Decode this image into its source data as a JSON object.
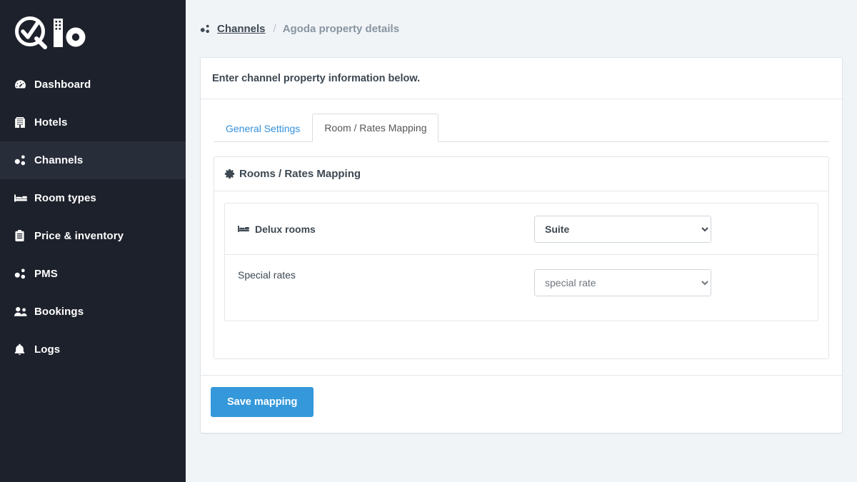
{
  "brand": {
    "logo_text": "io",
    "logo_name": "qio-logo"
  },
  "sidebar": {
    "items": [
      {
        "label": "Dashboard",
        "icon": "dashboard-gauge-icon",
        "active": false
      },
      {
        "label": "Hotels",
        "icon": "building-icon",
        "active": false
      },
      {
        "label": "Channels",
        "icon": "channels-nodes-icon",
        "active": true
      },
      {
        "label": "Room types",
        "icon": "bed-icon",
        "active": false
      },
      {
        "label": "Price & inventory",
        "icon": "clipboard-icon",
        "active": false
      },
      {
        "label": "PMS",
        "icon": "channels-nodes-icon",
        "active": false
      },
      {
        "label": "Bookings",
        "icon": "users-icon",
        "active": false
      },
      {
        "label": "Logs",
        "icon": "bell-icon",
        "active": false
      }
    ]
  },
  "breadcrumb": {
    "icon": "channels-nodes-icon",
    "current": "Channels",
    "separator": "/",
    "trail": "Agoda property details"
  },
  "card": {
    "header": "Enter channel property information below."
  },
  "tabs": [
    {
      "label": "General Settings",
      "active": false
    },
    {
      "label": "Room / Rates Mapping",
      "active": true
    }
  ],
  "panel": {
    "icon": "gear-icon",
    "title": "Rooms / Rates Mapping",
    "rows": [
      {
        "label": "Delux rooms",
        "icon": "bed-icon",
        "bold": true,
        "select_value": "Suite",
        "select_options": [
          "Suite"
        ],
        "select_style": "strong"
      },
      {
        "label": "Special rates",
        "icon": "",
        "bold": false,
        "select_value": "special rate",
        "select_options": [
          "special rate"
        ],
        "select_style": "muted"
      }
    ]
  },
  "footer": {
    "save_label": "Save mapping"
  },
  "colors": {
    "sidebar_bg": "#1d212b",
    "sidebar_active_bg": "#282d3a",
    "page_bg": "#f1f4f7",
    "primary": "#3498db",
    "link": "#3490dc",
    "text": "#3d4852",
    "muted": "#8795a1"
  }
}
